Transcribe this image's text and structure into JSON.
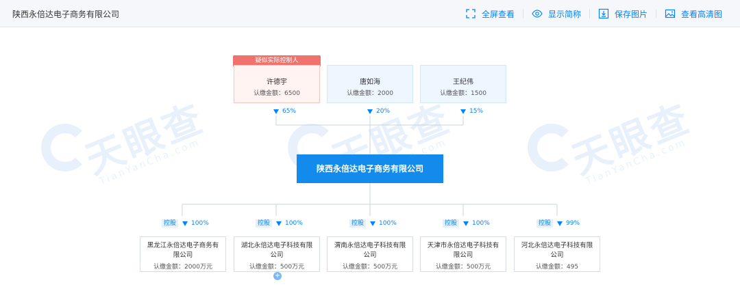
{
  "header": {
    "company_name": "陕西永倍达电子商务有限公司",
    "tools": [
      {
        "label": "全屏查看",
        "icon": "fullscreen-icon"
      },
      {
        "label": "显示简称",
        "icon": "eye-icon"
      },
      {
        "label": "保存图片",
        "icon": "download-icon"
      },
      {
        "label": "查看高清图",
        "icon": "image-icon"
      }
    ]
  },
  "watermark": {
    "text": "天眼查",
    "sub": "TianYanCha.com"
  },
  "shareholders": [
    {
      "tag": "疑似实际控制人",
      "name": "许德宇",
      "amount": "认缴金额：6500",
      "percent": "65%"
    },
    {
      "name": "唐如海",
      "amount": "认缴金额：2000",
      "percent": "20%"
    },
    {
      "name": "王纪伟",
      "amount": "认缴金额：1500",
      "percent": "15%"
    }
  ],
  "center": {
    "name": "陕西永倍达电子商务有限公司"
  },
  "subsidiaries": [
    {
      "tag": "控股",
      "percent": "100%",
      "name_line1": "黑龙江永倍达电子商务有",
      "name_line2": "限公司",
      "amount": "认缴金额：2000万元"
    },
    {
      "tag": "控股",
      "percent": "100%",
      "name_line1": "湖北永倍达电子科技有限",
      "name_line2": "公司",
      "amount": "认缴金额：500万元"
    },
    {
      "tag": "控股",
      "percent": "100%",
      "name_line1": "渭南永倍达电子科技有限",
      "name_line2": "公司",
      "amount": "认缴金额：500万元"
    },
    {
      "tag": "控股",
      "percent": "100%",
      "name_line1": "天津市永倍达电子科技有",
      "name_line2": "限公司",
      "amount": "认缴金额：500万元"
    },
    {
      "tag": "控股",
      "percent": "99%",
      "name_line1": "河北永倍达电子科技有限",
      "name_line2": "公司",
      "amount": "认缴金额：495"
    }
  ],
  "expand_label": "+",
  "colors": {
    "accent": "#128bed",
    "link": "#0084ff",
    "control_tag": "#f0726c"
  }
}
